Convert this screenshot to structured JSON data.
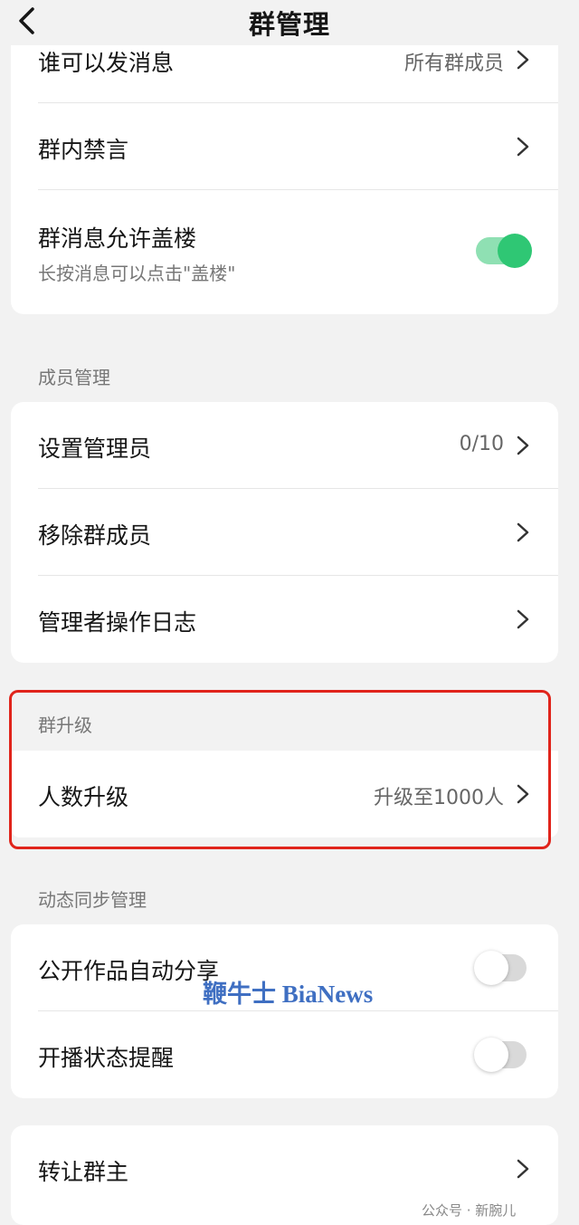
{
  "header": {
    "title": "群管理"
  },
  "group1": {
    "who_can_send": {
      "label": "谁可以发消息",
      "value": "所有群成员"
    },
    "group_mute": {
      "label": "群内禁言"
    },
    "stack_replies": {
      "label": "群消息允许盖楼",
      "sublabel": "长按消息可以点击\"盖楼\"",
      "enabled": true
    }
  },
  "members": {
    "section_title": "成员管理",
    "set_admin": {
      "label": "设置管理员",
      "value": "0/10"
    },
    "remove_members": {
      "label": "移除群成员"
    },
    "admin_log": {
      "label": "管理者操作日志"
    }
  },
  "upgrade": {
    "section_title": "群升级",
    "member_upgrade": {
      "label": "人数升级",
      "value": "升级至1000人"
    }
  },
  "sync": {
    "section_title": "动态同步管理",
    "auto_share": {
      "label": "公开作品自动分享",
      "enabled": false
    },
    "live_reminder": {
      "label": "开播状态提醒",
      "enabled": false
    }
  },
  "transfer": {
    "label": "转让群主"
  },
  "overlay": {
    "watermark": "鞭牛士 BiaNews",
    "credit": "公众号 · 新腕儿"
  },
  "colors": {
    "accent_green": "#2fc774",
    "highlight_red": "#e0241b",
    "background": "#f2f2f2"
  },
  "icons": {
    "back": "chevron-left-icon",
    "row_arrow": "chevron-right-icon"
  }
}
